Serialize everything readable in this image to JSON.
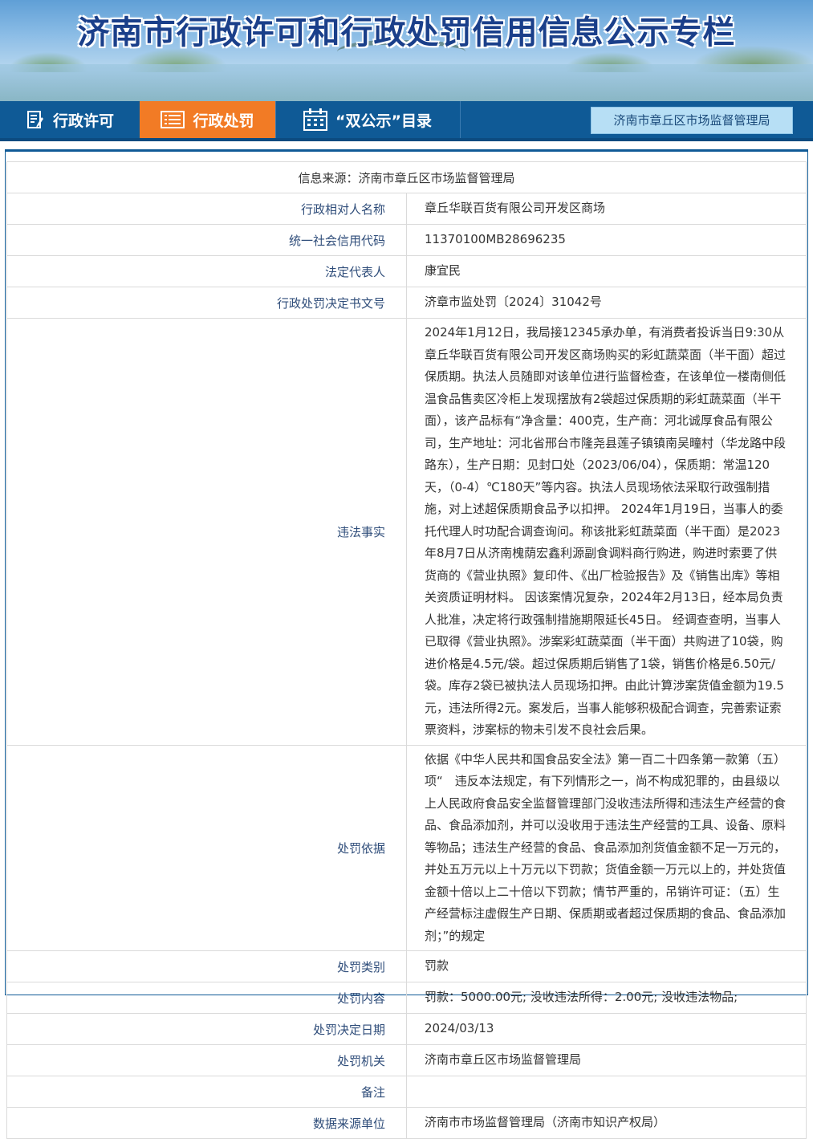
{
  "banner": {
    "title": "济南市行政许可和行政处罚信用信息公示专栏"
  },
  "nav": {
    "items": [
      {
        "label": "行政许可",
        "icon": "document-edit-icon"
      },
      {
        "label": "行政处罚",
        "icon": "list-icon",
        "active": true
      },
      {
        "label": "“双公示”目录",
        "icon": "calendar-icon"
      }
    ],
    "agency": "济南市章丘区市场监督管理局",
    "bar_color": "#0f5a96",
    "active_color": "#f27b25"
  },
  "record": {
    "source": "信息来源：济南市章丘区市场监督管理局",
    "rows": [
      {
        "label": "行政相对人名称",
        "value": "章丘华联百货有限公司开发区商场"
      },
      {
        "label": "统一社会信用代码",
        "value": "11370100MB28696235"
      },
      {
        "label": "法定代表人",
        "value": "康宜民"
      },
      {
        "label": "行政处罚决定书文号",
        "value": "济章市监处罚〔2024〕31042号"
      },
      {
        "label": "违法事实",
        "value": "2024年1月12日，我局接12345承办单，有消费者投诉当日9:30从章丘华联百货有限公司开发区商场购买的彩虹蔬菜面（半干面）超过保质期。执法人员随即对该单位进行监督检查，在该单位一楼南侧低温食品售卖区冷柜上发现摆放有2袋超过保质期的彩虹蔬菜面（半干面），该产品标有“净含量：400克，生产商：河北诚厚食品有限公司，生产地址：河北省邢台市隆尧县莲子镇镇南吴疃村（华龙路中段路东），生产日期：见封口处（2023/06/04），保质期：常温120天，（0-4）℃180天”等内容。执法人员现场依法采取行政强制措施，对上述超保质期食品予以扣押。 2024年1月19日，当事人的委托代理人时功配合调查询问。称该批彩虹蔬菜面（半干面）是2023年8月7日从济南槐荫宏鑫利源副食调料商行购进，购进时索要了供货商的《营业执照》复印件、《出厂检验报告》及《销售出库》等相关资质证明材料。 因该案情况复杂，2024年2月13日，经本局负责人批准，决定将行政强制措施期限延长45日。 经调查查明，当事人已取得《营业执照》。涉案彩虹蔬菜面（半干面）共购进了10袋，购进价格是4.5元/袋。超过保质期后销售了1袋，销售价格是6.50元/袋。库存2袋已被执法人员现场扣押。由此计算涉案货值金额为19.5元，违法所得2元。案发后，当事人能够积极配合调查，完善索证索票资料，涉案标的物未引发不良社会后果。"
      },
      {
        "label": "处罚依据",
        "value": "依据《中华人民共和国食品安全法》第一百二十四条第一款第（五）项“　违反本法规定，有下列情形之一，尚不构成犯罪的，由县级以上人民政府食品安全监督管理部门没收违法所得和违法生产经营的食品、食品添加剂，并可以没收用于违法生产经营的工具、设备、原料等物品；违法生产经营的食品、食品添加剂货值金额不足一万元的，并处五万元以上十万元以下罚款；货值金额一万元以上的，并处货值金额十倍以上二十倍以下罚款；情节严重的，吊销许可证：（五）生产经营标注虚假生产日期、保质期或者超过保质期的食品、食品添加剂；”的规定"
      },
      {
        "label": "处罚类别",
        "value": "罚款"
      },
      {
        "label": "处罚内容",
        "value": "罚款：5000.00元; 没收违法所得：2.00元; 没收违法物品;"
      },
      {
        "label": "处罚决定日期",
        "value": "2024/03/13"
      },
      {
        "label": "处罚机关",
        "value": "济南市章丘区市场监督管理局"
      },
      {
        "label": "备注",
        "value": ""
      },
      {
        "label": "数据来源单位",
        "value": "济南市市场监督管理局（济南市知识产权局）"
      }
    ]
  }
}
